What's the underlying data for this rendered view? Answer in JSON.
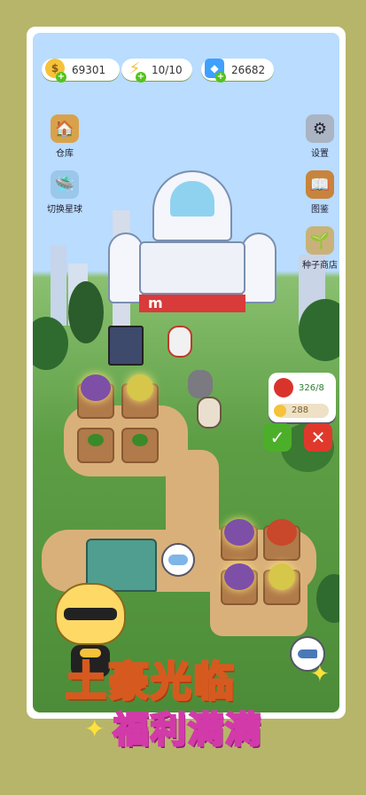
{
  "resources": {
    "coins": "69301",
    "energy": "10/10",
    "gems": "26682"
  },
  "left_menu": [
    {
      "label": "仓库",
      "icon": "warehouse-icon"
    },
    {
      "label": "切换星球",
      "icon": "planet-ufo-icon"
    }
  ],
  "right_menu": [
    {
      "label": "设置",
      "icon": "gear-icon"
    },
    {
      "label": "图鉴",
      "icon": "book-icon"
    },
    {
      "label": "种子商店",
      "icon": "seed-bag-icon"
    }
  ],
  "shop_sign": "m",
  "crop_panel": {
    "amount": "326/8",
    "price": "288"
  },
  "slogan": {
    "line1": "土豪光临",
    "line2": "福利满满"
  },
  "colors": {
    "background": "#b7b56a",
    "confirm": "#4caf2a",
    "cancel": "#e0392b",
    "coin": "#f5c23a",
    "gem": "#3fa0ff"
  }
}
